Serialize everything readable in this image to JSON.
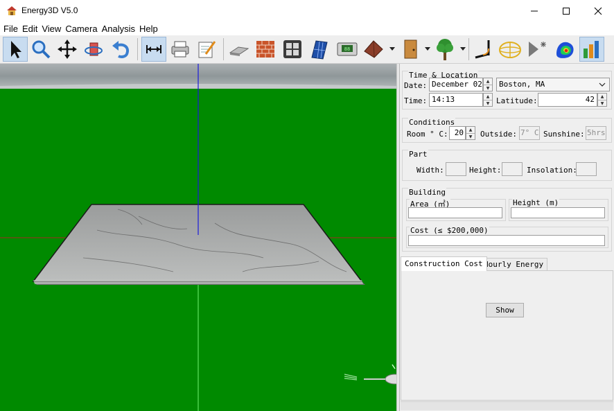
{
  "window": {
    "title": "Energy3D V5.0"
  },
  "menu": [
    "File",
    "Edit",
    "View",
    "Camera",
    "Analysis",
    "Help"
  ],
  "time_location": {
    "title": "Time & Location",
    "date_label": "Date:",
    "date_value": "December 02",
    "city_value": "Boston, MA",
    "time_label": "Time:",
    "time_value": "14:13",
    "latitude_label": "Latitude:",
    "latitude_value": "42"
  },
  "conditions": {
    "title": "Conditions",
    "room_label": "Room ° C:",
    "room_value": "20",
    "outside_label": "Outside:",
    "outside_value": "7° C",
    "sunshine_label": "Sunshine:",
    "sunshine_value": "5hrs"
  },
  "part": {
    "title": "Part",
    "width_label": "Width:",
    "height_label": "Height:",
    "insolation_label": "Insolation:"
  },
  "building": {
    "title": "Building",
    "area_label": "Area (㎡)",
    "height_label": "Height (m)",
    "cost_label": "Cost (≤ $200,000)"
  },
  "tabs": {
    "construction_cost": "Construction Cost",
    "hourly_energy": "Hourly Energy"
  },
  "buttons": {
    "show": "Show"
  },
  "icons": [
    "select-arrow-icon",
    "zoom-icon",
    "move-icon",
    "rotate-icon",
    "undo-icon",
    "resize-icon",
    "printer-icon",
    "note-icon",
    "foundation-icon",
    "wall-icon",
    "window-icon",
    "solar-panel-icon",
    "thermostat-icon",
    "roof-icon",
    "door-icon",
    "tree-icon",
    "sun-angle-icon",
    "sun-path-icon",
    "sun-light-icon",
    "heatmap-icon",
    "energy-graph-icon"
  ],
  "colors": {
    "ground": "#008a00",
    "sky": "#9aa3a5",
    "toolbar_selected": "#c8dcf0"
  }
}
